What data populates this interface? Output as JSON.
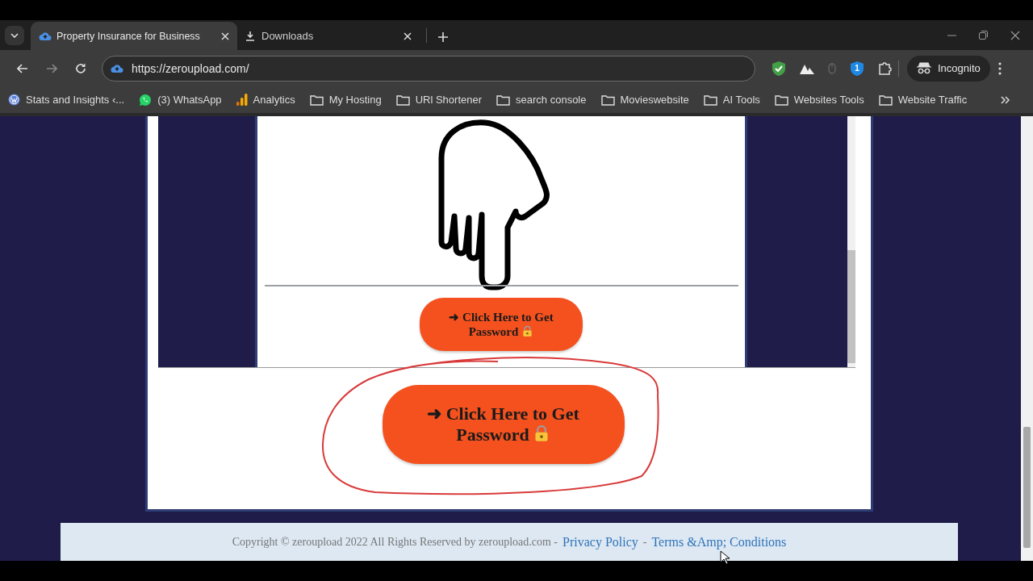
{
  "tabs": [
    {
      "label": "Property Insurance for Business",
      "selected": true,
      "kind": "site"
    },
    {
      "label": "Downloads",
      "selected": false,
      "kind": "download"
    }
  ],
  "address": "https://zeroupload.com/",
  "extension_badge": "1",
  "profile": "Incognito",
  "bookmarks": [
    {
      "label": "Stats and Insights ‹...",
      "kind": "wordpress"
    },
    {
      "label": "(3) WhatsApp",
      "kind": "whatsapp"
    },
    {
      "label": "Analytics",
      "kind": "analytics"
    },
    {
      "label": "My Hosting",
      "kind": "folder"
    },
    {
      "label": "URl Shortener",
      "kind": "folder"
    },
    {
      "label": "search console",
      "kind": "folder"
    },
    {
      "label": "Movieswebsite",
      "kind": "folder"
    },
    {
      "label": "AI Tools",
      "kind": "folder"
    },
    {
      "label": "Websites Tools",
      "kind": "folder"
    },
    {
      "label": "Website Traffic",
      "kind": "folder"
    }
  ],
  "page": {
    "small_button": "➜ Click Here to Get Password",
    "big_button": "➜ Click Here to Get Password",
    "footer": [
      {
        "kind": "text",
        "text": "Copyright © zeroupload 2022 All Rights Reserved by zeroupload.com -"
      },
      {
        "kind": "link",
        "text": "Privacy Policy"
      },
      {
        "kind": "text",
        "text": "-"
      },
      {
        "kind": "link",
        "text": "Terms &Amp; Conditions"
      }
    ]
  }
}
